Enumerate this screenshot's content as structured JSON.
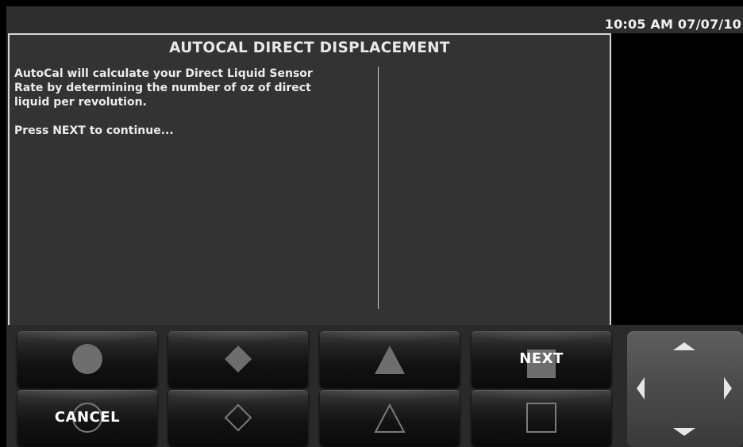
{
  "status_bar": {
    "clock": "10:05 AM 07/07/10"
  },
  "panel": {
    "title": "AUTOCAL DIRECT DISPLACEMENT",
    "paragraph_1": "AutoCal will calculate your Direct Liquid Sensor\nRate by determining the number of oz of direct\nliquid per revolution.",
    "paragraph_2": "Press NEXT to continue..."
  },
  "buttons": {
    "top_row": [
      {
        "label": "",
        "icon": "filled-circle-icon"
      },
      {
        "label": "",
        "icon": "filled-diamond-icon"
      },
      {
        "label": "",
        "icon": "filled-triangle-icon"
      },
      {
        "label": "NEXT",
        "icon": "filled-square-icon"
      }
    ],
    "bottom_row": [
      {
        "label": "CANCEL",
        "icon": "outline-circle-icon"
      },
      {
        "label": "",
        "icon": "outline-diamond-icon"
      },
      {
        "label": "",
        "icon": "outline-triangle-icon"
      },
      {
        "label": "",
        "icon": "outline-square-icon"
      }
    ]
  },
  "dpad": {
    "icons": [
      "up-arrow-icon",
      "left-arrow-icon",
      "right-arrow-icon",
      "down-arrow-icon"
    ]
  },
  "colors": {
    "panel_bg": "#333333",
    "panel_border": "#d8d8d8",
    "text": "#ececec",
    "symbol_fill": "#6e6e6e"
  }
}
